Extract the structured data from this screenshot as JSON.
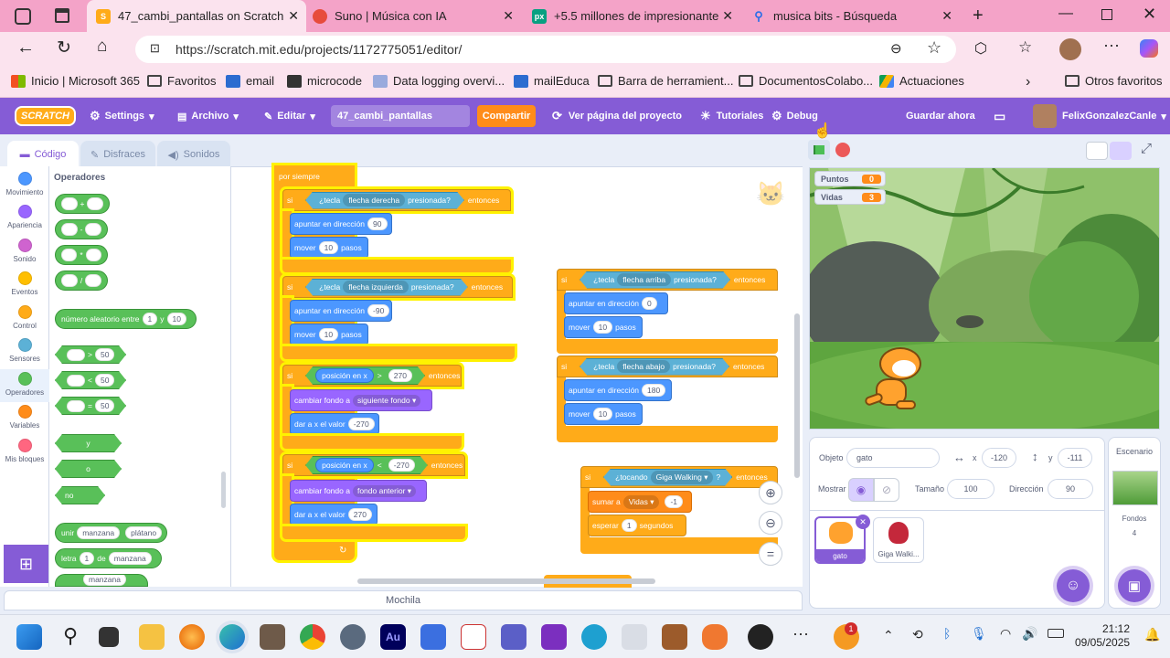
{
  "browser": {
    "tabs": [
      {
        "title": "47_cambi_pantallas on Scratch",
        "active": true
      },
      {
        "title": "Suno | Música con IA",
        "active": false
      },
      {
        "title": "+5.5 millones de impresionantes",
        "active": false
      },
      {
        "title": "musica bits - Búsqueda",
        "active": false
      }
    ],
    "url": "https://scratch.mit.edu/projects/1172775051/editor/",
    "favorites": [
      "Inicio | Microsoft 365",
      "Favoritos",
      "email",
      "microcode",
      "Data logging overvi...",
      "mailEduca",
      "Barra de herramient...",
      "DocumentosColabo...",
      "Actuaciones"
    ],
    "other_favorites": "Otros favoritos"
  },
  "menubar": {
    "logo": "SCRATCH",
    "settings": "Settings",
    "file": "Archivo",
    "edit": "Editar",
    "project_title": "47_cambi_pantallas",
    "share": "Compartir",
    "see_project": "Ver página del proyecto",
    "tutorials": "Tutoriales",
    "debug": "Debug",
    "save_now": "Guardar ahora",
    "username": "FelixGonzalezCanle"
  },
  "editor_tabs": {
    "code": "Código",
    "costumes": "Disfraces",
    "sounds": "Sonidos"
  },
  "categories": [
    {
      "label": "Movimiento",
      "color": "#4c97ff"
    },
    {
      "label": "Apariencia",
      "color": "#9966ff"
    },
    {
      "label": "Sonido",
      "color": "#cf63cf"
    },
    {
      "label": "Eventos",
      "color": "#ffbf00"
    },
    {
      "label": "Control",
      "color": "#ffab19"
    },
    {
      "label": "Sensores",
      "color": "#5cb1d6"
    },
    {
      "label": "Operadores",
      "color": "#59c059"
    },
    {
      "label": "Variables",
      "color": "#ff8c1a"
    },
    {
      "label": "Mis bloques",
      "color": "#ff6680"
    }
  ],
  "palette": {
    "heading": "Operadores",
    "ops": [
      "+",
      "-",
      "*",
      "/"
    ],
    "random": {
      "label": "número aleatorio entre",
      "a": "1",
      "y": "y",
      "b": "10"
    },
    "compare": [
      ">",
      "<",
      "="
    ],
    "compare_value": "50",
    "bool": [
      "y",
      "o",
      "no"
    ],
    "join": {
      "label": "unir",
      "a": "manzana",
      "b": "plátano"
    },
    "letter": {
      "label": "letra",
      "n": "1",
      "de": "de",
      "word": "manzana"
    },
    "partial": "manzana"
  },
  "scripts": {
    "forever": "por siempre",
    "if": "si",
    "then": "entonces",
    "key": "¿tecla",
    "pressed": "presionada?",
    "point": "apuntar en dirección",
    "move": "mover",
    "steps": "pasos",
    "right": "flecha derecha",
    "left": "flecha izquierda",
    "up": "flecha arriba",
    "down": "flecha abajo",
    "dir_right": "90",
    "dir_left": "-90",
    "dir_up": "0",
    "dir_down": "180",
    "steps_val": "10",
    "xpos": "posición en x",
    "gt": ">",
    "lt": "<",
    "x_max": "270",
    "x_min": "-270",
    "switch_bg": "cambiar fondo a",
    "next_bg": "siguiente fondo",
    "prev_bg": "fondo anterior",
    "set_x": "dar a x el valor",
    "set_x_val1": "-270",
    "set_x_val2": "270",
    "touching": "¿tocando",
    "giga": "Giga Walking",
    "q": "?",
    "change": "sumar a",
    "lives": "Vidas",
    "change_val": "-1",
    "wait": "esperar",
    "wait_val": "1",
    "seconds": "segundos",
    "backpack": "Mochila"
  },
  "stage": {
    "monitors": [
      {
        "label": "Puntos",
        "value": "0"
      },
      {
        "label": "Vidas",
        "value": "3"
      }
    ]
  },
  "sprite_info": {
    "sprite_label": "Objeto",
    "sprite_name": "gato",
    "x_label": "x",
    "x": "-120",
    "y_label": "y",
    "y": "-111",
    "show_label": "Mostrar",
    "size_label": "Tamaño",
    "size": "100",
    "direction_label": "Dirección",
    "direction": "90",
    "sprites": [
      "gato",
      "Giga Walki..."
    ],
    "stage_label": "Escenario",
    "backdrops_label": "Fondos",
    "backdrops_count": "4"
  },
  "taskbar": {
    "time": "21:12",
    "date": "09/05/2025",
    "badge": "1"
  }
}
